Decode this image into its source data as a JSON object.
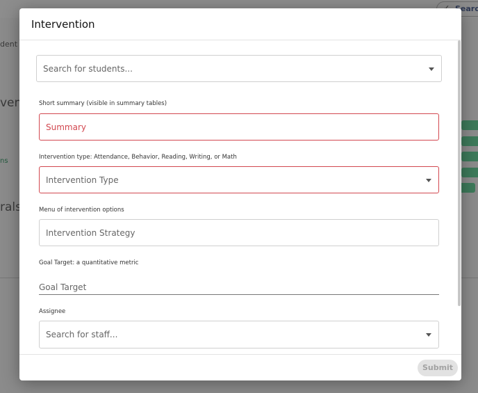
{
  "background": {
    "search_label": "Search",
    "text_1": "dent",
    "text_2": "vent",
    "text_3": "ns",
    "text_4": "rals"
  },
  "modal": {
    "title": "Intervention",
    "student_search": {
      "placeholder": "Search for students..."
    },
    "summary": {
      "label": "Short summary (visible in summary tables)",
      "placeholder": "Summary"
    },
    "type": {
      "label": "Intervention type: Attendance, Behavior, Reading, Writing, or Math",
      "placeholder": "Intervention Type"
    },
    "strategy": {
      "label": "Menu of intervention options",
      "placeholder": "Intervention Strategy"
    },
    "goal": {
      "label": "Goal Target: a quantitative metric",
      "placeholder": "Goal Target"
    },
    "assignee": {
      "label": "Assignee",
      "placeholder": "Search for staff..."
    },
    "submit_label": "Submit"
  },
  "colors": {
    "error": "#d2474f",
    "accent_green": "#3d7a5a"
  }
}
